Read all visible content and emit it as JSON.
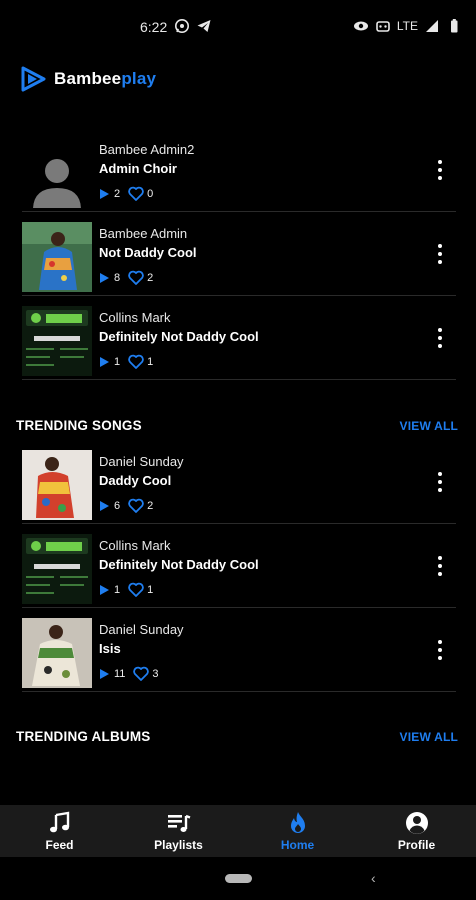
{
  "status_bar": {
    "time": "6:22",
    "network": "LTE",
    "left_icons": [
      "whatsapp-icon",
      "telegram-icon"
    ],
    "right_icons": [
      "eye-icon",
      "cast-icon",
      "signal-icon",
      "battery-icon"
    ]
  },
  "app": {
    "logo_primary": "Bambee",
    "logo_accent": "play",
    "accent_color": "#1f7ef0",
    "background_color": "#000000"
  },
  "recent_list": [
    {
      "artist": "Bambee Admin2",
      "title": "Admin Choir",
      "plays": "2",
      "likes": "0",
      "thumb": "placeholder-avatar"
    },
    {
      "artist": "Bambee Admin",
      "title": "Not Daddy Cool",
      "plays": "8",
      "likes": "2",
      "thumb": "woman-in-print-dress"
    },
    {
      "artist": "Collins Mark",
      "title": "Definitely Not Daddy Cool",
      "plays": "1",
      "likes": "1",
      "thumb": "yts-poster"
    }
  ],
  "trending_songs": {
    "heading": "TRENDING SONGS",
    "view_all": "VIEW ALL",
    "items": [
      {
        "artist": "Daniel Sunday",
        "title": "Daddy Cool",
        "plays": "6",
        "likes": "2",
        "thumb": "woman-in-print-dress"
      },
      {
        "artist": "Collins Mark",
        "title": "Definitely Not Daddy Cool",
        "plays": "1",
        "likes": "1",
        "thumb": "yts-poster"
      },
      {
        "artist": "Daniel Sunday",
        "title": "Isis",
        "plays": "11",
        "likes": "3",
        "thumb": "woman-in-print-dress"
      }
    ]
  },
  "trending_albums": {
    "heading": "TRENDING ALBUMS",
    "view_all": "VIEW ALL"
  },
  "bottom_nav": [
    {
      "label": "Feed",
      "icon": "music-notes-icon",
      "active": false
    },
    {
      "label": "Playlists",
      "icon": "playlist-icon",
      "active": false
    },
    {
      "label": "Home",
      "icon": "fire-icon",
      "active": true
    },
    {
      "label": "Profile",
      "icon": "account-circle-icon",
      "active": false
    }
  ]
}
